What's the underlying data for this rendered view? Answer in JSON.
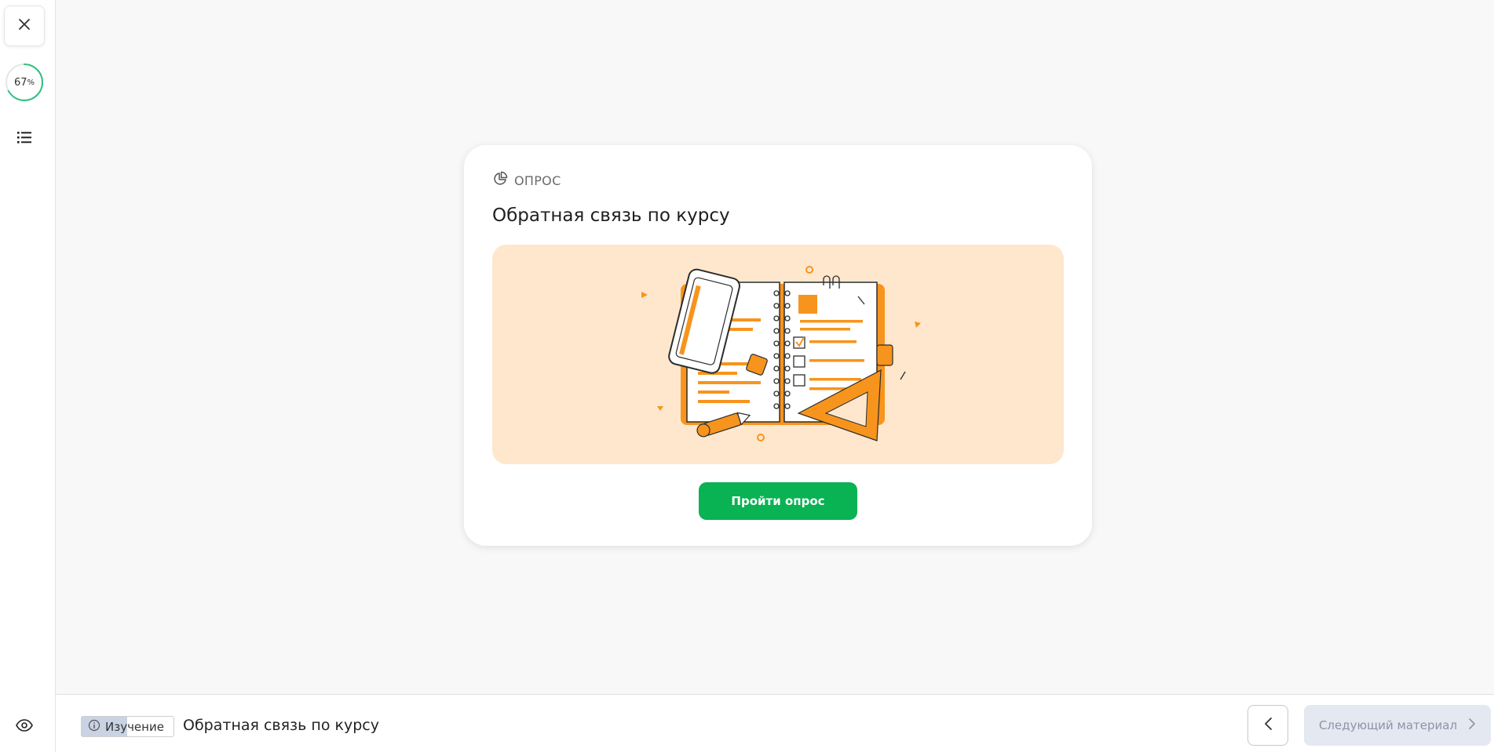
{
  "sidebar": {
    "close_icon": "close-icon",
    "progress": {
      "value": 67,
      "unit": "%",
      "color": "#2ec27e"
    },
    "toc_icon": "list-icon",
    "preview_icon": "eye-icon"
  },
  "card": {
    "type_label": "ОПРОС",
    "type_icon": "pie-chart-icon",
    "title": "Обратная связь по курсу",
    "illustration_bg": "#fee7cd",
    "accent": "#f7941d",
    "button_label": "Пройти опрос",
    "button_color": "#09b253"
  },
  "footer": {
    "mode_badge": "Изучение",
    "title": "Обратная связь по курсу",
    "prev_icon": "chevron-left-icon",
    "next_label": "Следующий материал",
    "next_icon": "chevron-right-icon"
  }
}
